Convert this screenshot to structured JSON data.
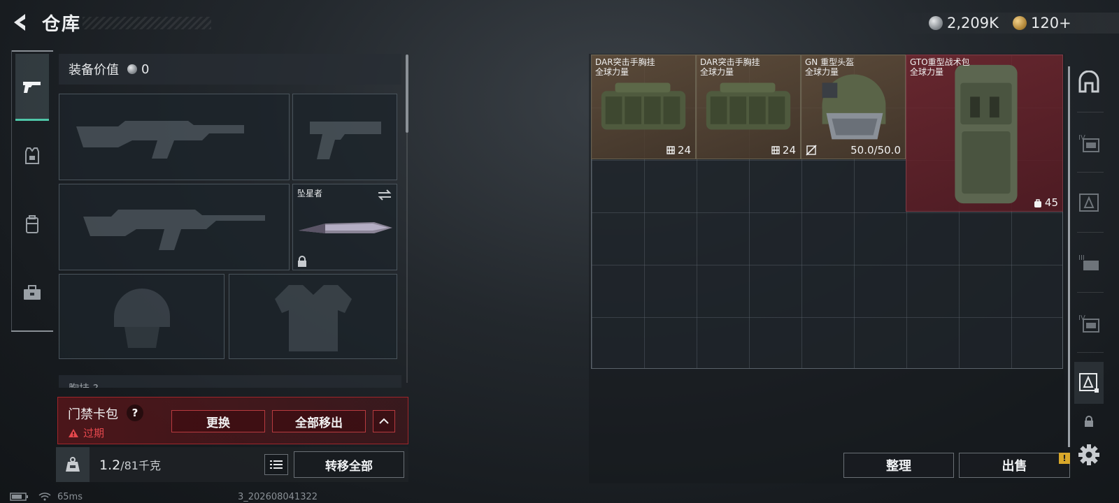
{
  "header": {
    "title": "仓库"
  },
  "currency": {
    "silver": "2,209K",
    "gold": "120+"
  },
  "loadout": {
    "value_label": "装备价值",
    "value": "0",
    "melee_slot_label": "坠星者",
    "next_section_label": "胸挂 ?"
  },
  "keycard": {
    "title": "门禁卡包",
    "help": "?",
    "status": "过期",
    "replace_label": "更换",
    "move_all_out_label": "全部移出",
    "collapse_icon": "chevron-up-icon"
  },
  "weight": {
    "current": "1.2",
    "capacity": "/81千克",
    "transfer_all_label": "转移全部"
  },
  "status_bar": {
    "ping": "65ms",
    "build": "3_202608041322"
  },
  "stash": {
    "items": [
      {
        "name": "DAR突击手胸挂",
        "sub": "全球力量",
        "badge": "24",
        "badge_icon": "capacity-icon"
      },
      {
        "name": "DAR突击手胸挂",
        "sub": "全球力量",
        "badge": "24",
        "badge_icon": "capacity-icon"
      },
      {
        "name": "GN 重型头盔",
        "sub": "全球力量",
        "badge": "50.0/50.0",
        "badge_icon": "no-repair-icon"
      },
      {
        "name": "GTO重型战术包",
        "sub": "全球力量",
        "badge": "45",
        "badge_icon": "backpack-icon"
      }
    ],
    "sort_label": "整理",
    "sell_label": "出售",
    "sell_alert": "!"
  },
  "colors": {
    "accent_green": "#4fc6a8",
    "alert_red": "#e5484d",
    "item_brown": "#6e563e",
    "item_red": "#782830",
    "warning_yellow": "#d8a72a"
  },
  "icons": {
    "back": "back-arrow-icon",
    "category_tabs": [
      "pistol-icon",
      "armor-vest-icon",
      "backpack-icon",
      "toolbox-icon"
    ],
    "stash_tabs": [
      "stash-home-icon",
      "stash-tier4-icon",
      "stash-armor-icon",
      "stash-tier3-icon",
      "stash-tier4-b-icon",
      "stash-selected-icon",
      "lock-icon"
    ]
  }
}
